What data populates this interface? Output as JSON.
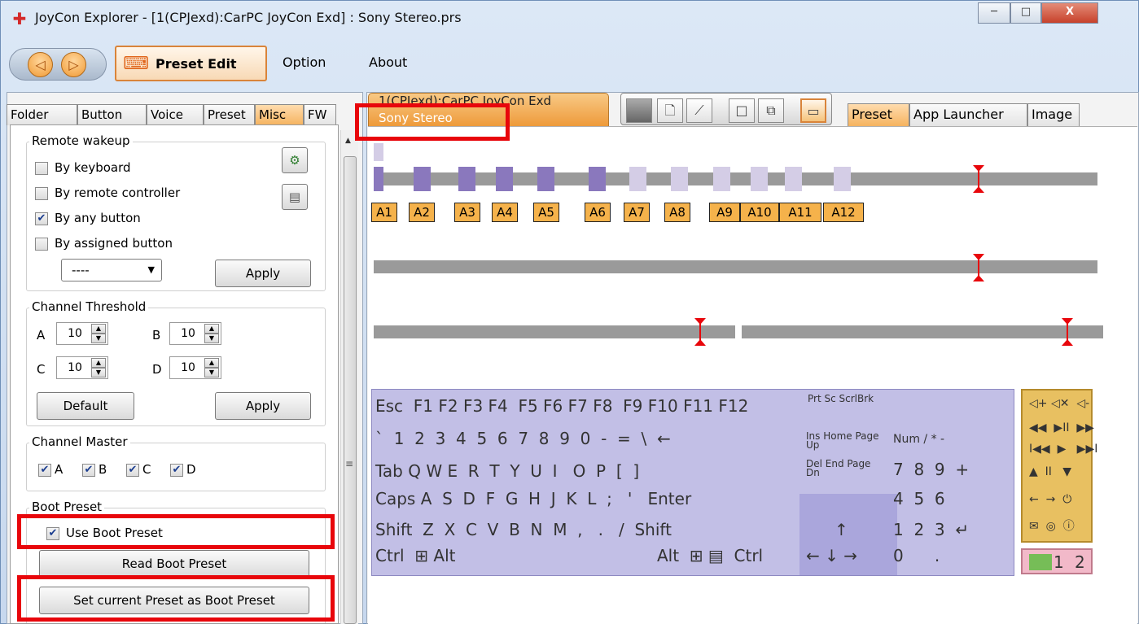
{
  "window": {
    "title": "JoyCon Explorer - [1(CPJexd):CarPC JoyCon Exd] : Sony Stereo.prs",
    "minimize": "─",
    "maximize": "□",
    "close": "X"
  },
  "toolbar": {
    "back": "◁",
    "forward": "▷",
    "preset_edit": "Preset Edit",
    "menus": [
      "Option",
      "About"
    ]
  },
  "left_tabs": [
    "Folder",
    "Button",
    "Voice",
    "Preset",
    "Misc",
    "FW"
  ],
  "remote_wakeup": {
    "title": "Remote wakeup",
    "options": [
      {
        "label": "By keyboard",
        "checked": false
      },
      {
        "label": "By remote controller",
        "checked": false
      },
      {
        "label": "By any button",
        "checked": true
      },
      {
        "label": "By assigned button",
        "checked": false
      }
    ],
    "dropdown_value": "----",
    "apply": "Apply"
  },
  "channel_threshold": {
    "title": "Channel Threshold",
    "channels": [
      {
        "name": "A",
        "value": "10"
      },
      {
        "name": "B",
        "value": "10"
      },
      {
        "name": "C",
        "value": "10"
      },
      {
        "name": "D",
        "value": "10"
      }
    ],
    "default": "Default",
    "apply": "Apply"
  },
  "channel_master": {
    "title": "Channel Master",
    "items": [
      {
        "label": "A",
        "checked": true
      },
      {
        "label": "B",
        "checked": true
      },
      {
        "label": "C",
        "checked": true
      },
      {
        "label": "D",
        "checked": true
      }
    ]
  },
  "boot_preset": {
    "title": "Boot Preset",
    "use_label": "Use Boot Preset",
    "use_checked": true,
    "read": "Read Boot Preset",
    "set_current": "Set current Preset as Boot Preset"
  },
  "doc_tab": {
    "device": "1(CPJexd):CarPC JoyCon Exd",
    "preset": "Sony Stereo"
  },
  "right_tabs": [
    "Preset",
    "App Launcher",
    "Image"
  ],
  "slots": [
    "A1",
    "A2",
    "A3",
    "A4",
    "A5",
    "A6",
    "A7",
    "A8",
    "A9",
    "A10",
    "A11",
    "A12"
  ],
  "keyboard": {
    "row1": "Esc  F1 F2 F3 F4  F5 F6 F7 F8  F9 F10 F11 F12",
    "row2": "`  1  2  3  4  5  6  7  8  9  0  -  =  \\  ←",
    "row3": "Tab Q W E  R  T  Y  U  I   O  P  [  ]",
    "row4": "Caps A  S  D  F  G  H  J  K  L  ;   '   Enter",
    "row5": "Shift  Z  X  C  V  B  N  M  ,   .   /  Shift",
    "row6": "Ctrl  ⊞ Alt",
    "row6_right": "Alt  ⊞ ▤  Ctrl",
    "nav1": "Ins Home Page Up",
    "nav2": "Del End Page Dn",
    "arrows_up": "↑",
    "arrows": "← ↓ →",
    "prt": "Prt Sc ScrlBrk",
    "num1": "Num /   *   -",
    "num2": "7  8  9  +",
    "num3": "4  5  6",
    "num4": "1  2  3  ↵",
    "num5": "0      ."
  },
  "media": {
    "row1": "◁+ ◁✕  ◁-",
    "row2": "◀◀  ▶II  ▶▶",
    "row3": "I◀◀  ▶   ▶▶I",
    "row4": "▲  II   ▼",
    "row5": "←  →  ⏻",
    "row6": "✉  ◎  ⓘ"
  },
  "indicator": {
    "one": "1",
    "two": "2"
  }
}
